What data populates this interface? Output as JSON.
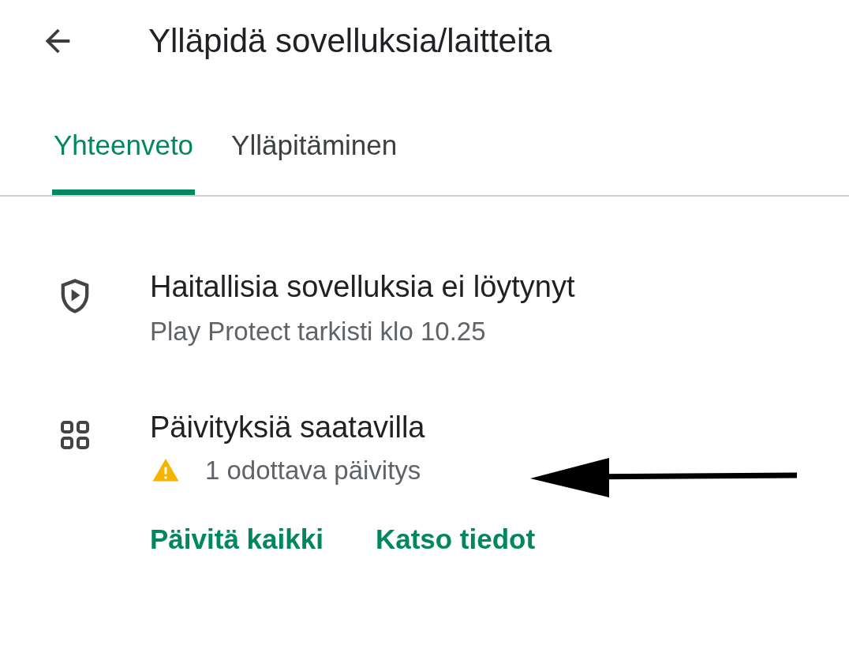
{
  "header": {
    "title": "Ylläpidä sovelluksia/laitteita"
  },
  "tabs": [
    {
      "label": "Yhteenveto",
      "selected": true
    },
    {
      "label": "Ylläpitäminen",
      "selected": false
    }
  ],
  "items": [
    {
      "kind": "protect",
      "title": "Haitallisia sovelluksia ei löytynyt",
      "subtitle": "Play Protect tarkisti klo 10.25"
    },
    {
      "kind": "updates",
      "title": "Päivityksiä saatavilla",
      "warning": "1 odottava päivitys",
      "actions": [
        "Päivitä kaikki",
        "Katso tiedot"
      ]
    }
  ]
}
